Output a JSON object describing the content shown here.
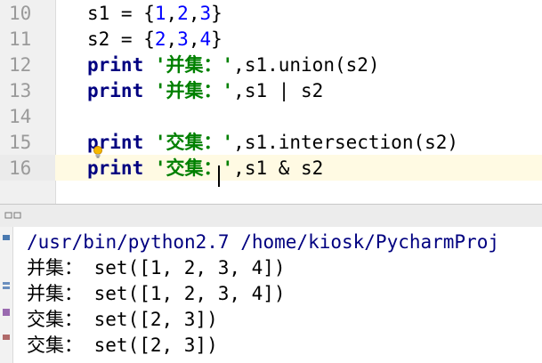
{
  "editor": {
    "lines": [
      {
        "num": "10",
        "parts": [
          {
            "t": "s1 = {",
            "c": "plain"
          },
          {
            "t": "1",
            "c": "num"
          },
          {
            "t": ",",
            "c": "plain"
          },
          {
            "t": "2",
            "c": "num"
          },
          {
            "t": ",",
            "c": "plain"
          },
          {
            "t": "3",
            "c": "num"
          },
          {
            "t": "}",
            "c": "plain"
          }
        ]
      },
      {
        "num": "11",
        "parts": [
          {
            "t": "s2 = {",
            "c": "plain"
          },
          {
            "t": "2",
            "c": "num"
          },
          {
            "t": ",",
            "c": "plain"
          },
          {
            "t": "3",
            "c": "num"
          },
          {
            "t": ",",
            "c": "plain"
          },
          {
            "t": "4",
            "c": "num"
          },
          {
            "t": "}",
            "c": "plain"
          }
        ]
      },
      {
        "num": "12",
        "parts": [
          {
            "t": "print",
            "c": "kw"
          },
          {
            "t": " ",
            "c": "plain"
          },
          {
            "t": "'并集：'",
            "c": "str"
          },
          {
            "t": ",s1.union(s2)",
            "c": "plain"
          }
        ]
      },
      {
        "num": "13",
        "parts": [
          {
            "t": "print",
            "c": "kw"
          },
          {
            "t": " ",
            "c": "plain"
          },
          {
            "t": "'并集：'",
            "c": "str"
          },
          {
            "t": ",s1 | s2",
            "c": "plain"
          }
        ]
      },
      {
        "num": "14",
        "parts": []
      },
      {
        "num": "15",
        "parts": [
          {
            "t": "print",
            "c": "kw"
          },
          {
            "t": " ",
            "c": "plain"
          },
          {
            "t": "'交集：'",
            "c": "str"
          },
          {
            "t": ",s1.intersection(s2)",
            "c": "plain"
          }
        ]
      },
      {
        "num": "16",
        "current": true,
        "parts": [
          {
            "t": "print",
            "c": "kw"
          },
          {
            "t": " ",
            "c": "plain"
          },
          {
            "t": "'交集：'",
            "c": "str"
          },
          {
            "t": ",s1 & s2",
            "c": "plain"
          }
        ]
      }
    ]
  },
  "console": {
    "command": "/usr/bin/python2.7 /home/kiosk/PycharmProj",
    "output": [
      "并集： set([1, 2, 3, 4])",
      "并集： set([1, 2, 3, 4])",
      "交集： set([2, 3])",
      "交集： set([2, 3])"
    ]
  },
  "icons": {
    "intention_bulb": "intention-bulb-icon",
    "minimize": "minimize-icon",
    "restore": "restore-icon"
  },
  "colors": {
    "keyword": "#000080",
    "number": "#0000ff",
    "string": "#008000",
    "current_line": "#fffae3",
    "gutter": "#f0f0f0",
    "console_command": "#000080"
  }
}
